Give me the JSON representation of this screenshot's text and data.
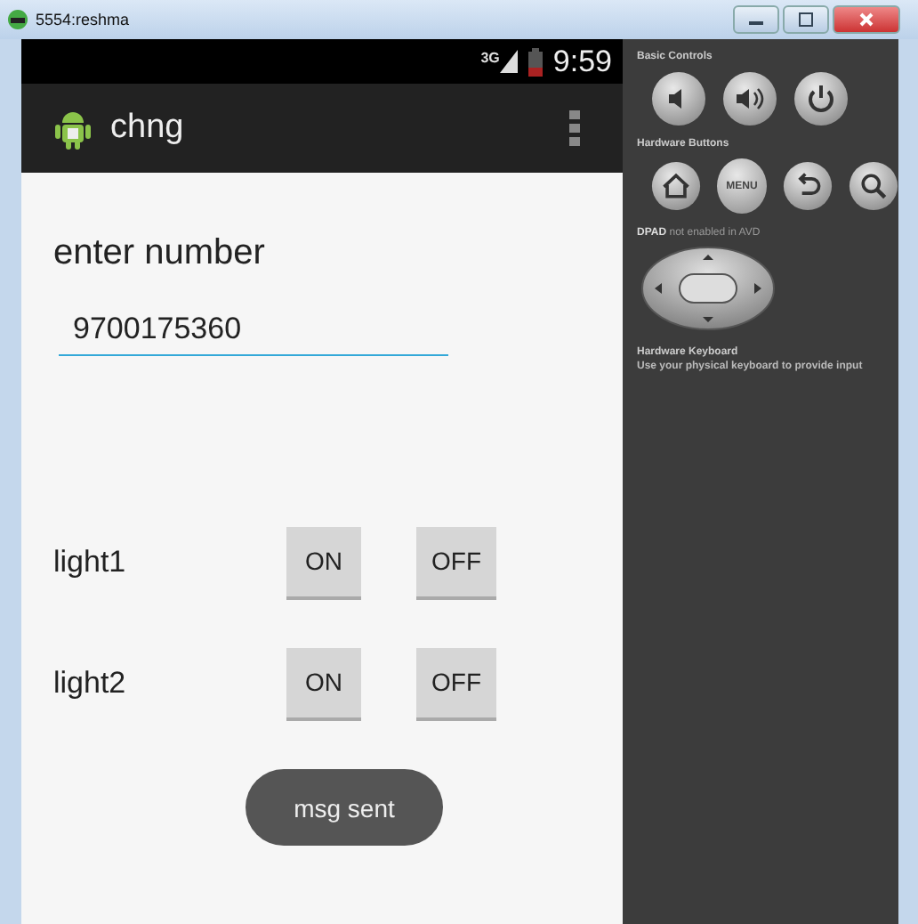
{
  "window": {
    "title": "5554:reshma"
  },
  "status_bar": {
    "network": "3G",
    "time": "9:59"
  },
  "action_bar": {
    "title": "chng"
  },
  "form": {
    "label": "enter number",
    "field": {
      "value": "9700175360"
    }
  },
  "lights": [
    {
      "label": "light1",
      "buttons": [
        "ON",
        "OFF"
      ]
    },
    {
      "label": "light2",
      "buttons": [
        "ON",
        "OFF"
      ]
    }
  ],
  "toast": "msg sent",
  "controls": {
    "basic_title": "Basic Controls",
    "hardware_title": "Hardware Buttons",
    "menu_label": "MENU",
    "dpad_note": "**DPAD** not enabled in AVD",
    "keyboard_title": "Hardware Keyboard",
    "keyboard_note": "Use your physical keyboard to provide input"
  }
}
